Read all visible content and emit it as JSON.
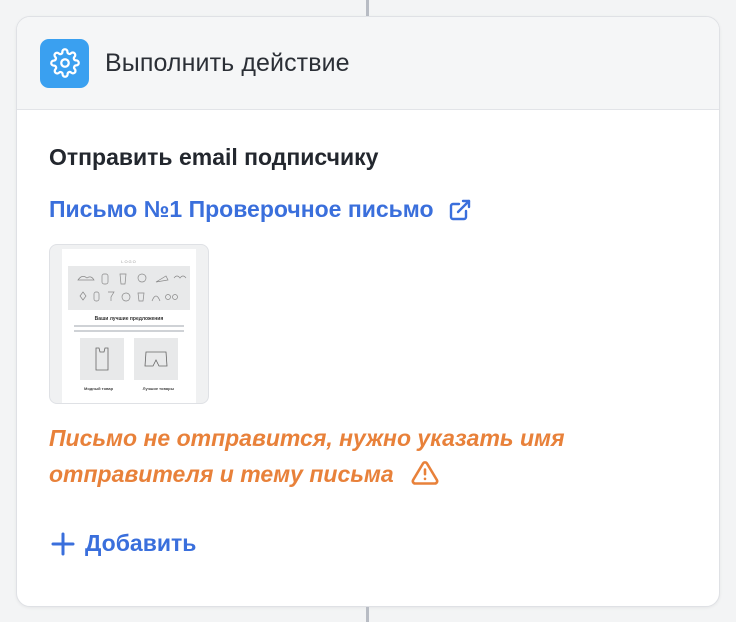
{
  "header": {
    "icon": "gear-icon",
    "title": "Выполнить действие"
  },
  "action": {
    "title": "Отправить email подписчику",
    "letter_link": "Письмо №1 Проверочное письмо",
    "link_icon": "external-link-icon",
    "thumbnail": {
      "logo": "LOGO",
      "heading": "Ваши лучшие предложения",
      "product_1": "Модный товар",
      "product_2": "Лучшие товары"
    },
    "warning": "Письмо не отправится, нужно указать имя отправителя и тему письма",
    "warning_icon": "warning-icon"
  },
  "footer": {
    "add_label": "Добавить",
    "add_icon": "plus-icon"
  },
  "colors": {
    "accent": "#3a6fdc",
    "gear_bg": "#3aa0f0",
    "warning": "#e8813a"
  }
}
